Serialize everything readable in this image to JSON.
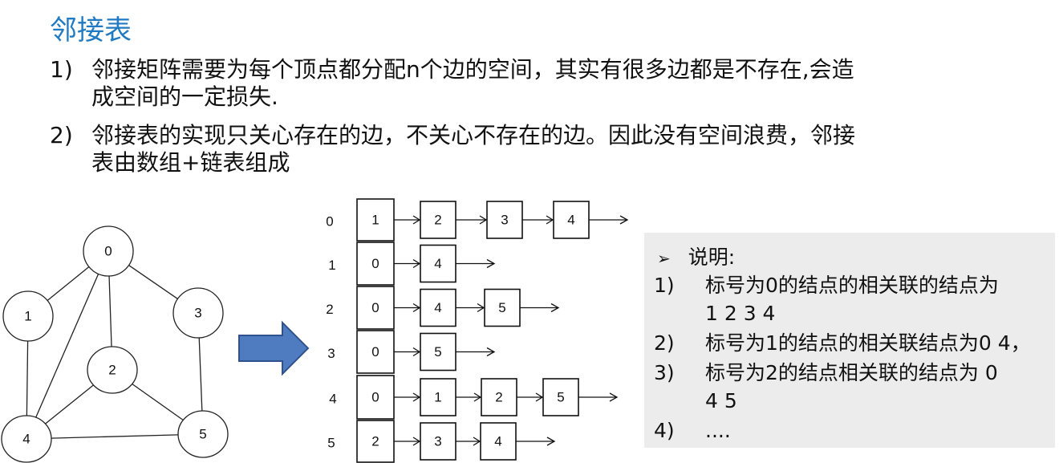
{
  "title": "邻接表",
  "points": [
    {
      "num": "1)",
      "lines": [
        "邻接矩阵需要为每个顶点都分配n个边的空间，其实有很多边都是不存在,会造",
        "成空间的一定损失."
      ]
    },
    {
      "num": "2)",
      "lines": [
        "邻接表的实现只关心存在的边，不关心不存在的边。因此没有空间浪费，邻接",
        "表由数组+链表组成"
      ]
    }
  ],
  "graph": {
    "nodes": [
      "0",
      "1",
      "2",
      "3",
      "4",
      "5"
    ],
    "edges": [
      [
        "0",
        "1"
      ],
      [
        "0",
        "3"
      ],
      [
        "0",
        "2"
      ],
      [
        "0",
        "4"
      ],
      [
        "1",
        "4"
      ],
      [
        "2",
        "4"
      ],
      [
        "2",
        "5"
      ],
      [
        "3",
        "5"
      ],
      [
        "4",
        "5"
      ]
    ]
  },
  "adjacency": {
    "indices": [
      "0",
      "1",
      "2",
      "3",
      "4",
      "5"
    ],
    "heads": [
      "1",
      "0",
      "0",
      "0",
      "0",
      "2"
    ],
    "lists": [
      [
        "2",
        "3",
        "4"
      ],
      [
        "4"
      ],
      [
        "4",
        "5"
      ],
      [
        "5"
      ],
      [
        "1",
        "2",
        "5"
      ],
      [
        "3",
        "4"
      ]
    ]
  },
  "note": {
    "bullet": "➢",
    "heading": "说明:",
    "items": [
      {
        "num": "1)",
        "lines": [
          "标号为0的结点的相关联的结点为",
          "1 2 3 4"
        ]
      },
      {
        "num": "2)",
        "lines": [
          "标号为1的结点的相关联结点为0 4，"
        ]
      },
      {
        "num": "3)",
        "lines": [
          "标号为2的结点相关联的结点为 0",
          "4 5"
        ]
      },
      {
        "num": "4)",
        "lines": [
          "...."
        ]
      }
    ]
  },
  "colors": {
    "title": "#1f7ac1",
    "arrow_fill": "#4f7cc0",
    "arrow_stroke": "#2f528f",
    "note_bg": "#ececec"
  }
}
